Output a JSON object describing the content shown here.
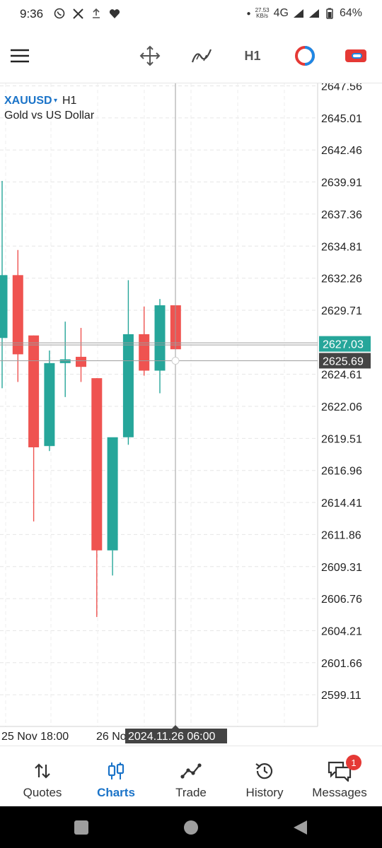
{
  "status_bar": {
    "time": "9:36",
    "net_speed_value": "27.53",
    "net_speed_unit": "KB/s",
    "network": "4G",
    "battery": "64%",
    "left_icons": [
      "whatsapp-icon",
      "x-icon",
      "upload-icon",
      "heart-icon"
    ]
  },
  "toolbar": {
    "timeframe_label": "H1",
    "icons": [
      "menu-icon",
      "crosshair-move-icon",
      "indicators-icon",
      "timeframe",
      "one-click-trading-icon",
      "trade-toggle-icon"
    ]
  },
  "chart": {
    "symbol": "XAUUSD",
    "dropdown_arrow": "▾",
    "timeframe": "H1",
    "description": "Gold vs US Dollar",
    "price_labels": [
      "2647.56",
      "2645.01",
      "2642.46",
      "2639.91",
      "2637.36",
      "2634.81",
      "2632.26",
      "2629.71",
      "2624.61",
      "2622.06",
      "2619.51",
      "2616.96",
      "2614.41",
      "2611.86",
      "2609.31",
      "2606.76",
      "2604.21",
      "2601.66",
      "2599.11"
    ],
    "bid_price": "2627.03",
    "crosshair_price": "2625.69",
    "time_labels": [
      "25 Nov 18:00",
      "26 No"
    ],
    "crosshair_time": "2024.11.26 06:00",
    "colors": {
      "bull": "#26a69a",
      "bear": "#ef5350",
      "bid_label": "#26a69a",
      "crosshair_label": "#444444"
    }
  },
  "chart_data": {
    "type": "candlestick",
    "symbol": "XAUUSD",
    "timeframe": "H1",
    "title": "Gold vs US Dollar",
    "ylim": [
      2597.0,
      2648.2
    ],
    "candles": [
      {
        "open": 2627.5,
        "high": 2640.0,
        "low": 2623.5,
        "close": 2632.5
      },
      {
        "open": 2632.5,
        "high": 2634.5,
        "low": 2624.0,
        "close": 2626.2
      },
      {
        "open": 2627.7,
        "high": 2627.7,
        "low": 2612.9,
        "close": 2618.8
      },
      {
        "open": 2618.9,
        "high": 2626.5,
        "low": 2618.5,
        "close": 2625.5
      },
      {
        "open": 2625.5,
        "high": 2628.8,
        "low": 2622.8,
        "close": 2625.8
      },
      {
        "open": 2626.0,
        "high": 2628.3,
        "low": 2624.0,
        "close": 2625.2
      },
      {
        "open": 2624.3,
        "high": 2624.3,
        "low": 2605.3,
        "close": 2610.6
      },
      {
        "open": 2610.6,
        "high": 2610.6,
        "low": 2608.6,
        "close": 2619.6
      },
      {
        "open": 2619.6,
        "high": 2632.1,
        "low": 2619.0,
        "close": 2627.8
      },
      {
        "open": 2627.8,
        "high": 2630.0,
        "low": 2624.5,
        "close": 2624.9
      },
      {
        "open": 2624.9,
        "high": 2630.6,
        "low": 2623.1,
        "close": 2630.1
      },
      {
        "open": 2630.1,
        "high": 2630.1,
        "low": 2626.6,
        "close": 2626.6
      }
    ],
    "bid": 2627.03,
    "crosshair_price": 2625.69,
    "crosshair_time": "2024.11.26 06:00",
    "x_ticks": [
      "25 Nov 18:00",
      "26 No"
    ]
  },
  "bottom_nav": {
    "items": [
      {
        "label": "Quotes",
        "icon": "quotes-icon",
        "active": false
      },
      {
        "label": "Charts",
        "icon": "charts-icon",
        "active": true
      },
      {
        "label": "Trade",
        "icon": "trade-icon",
        "active": false
      },
      {
        "label": "History",
        "icon": "history-icon",
        "active": false
      },
      {
        "label": "Messages",
        "icon": "messages-icon",
        "active": false
      }
    ],
    "messages_badge": "1"
  }
}
